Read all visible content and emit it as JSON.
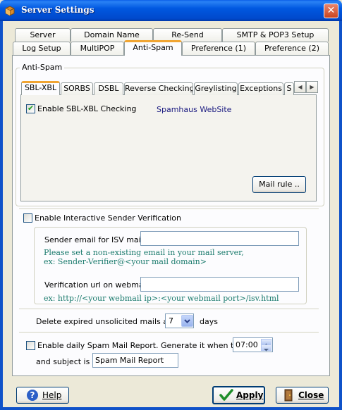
{
  "window": {
    "title": "Server Settings",
    "close_glyph": "✕"
  },
  "tabs_row1": [
    "Server",
    "Domain Name",
    "Re-Send",
    "SMTP & POP3 Setup"
  ],
  "tabs_row2": [
    "Log Setup",
    "MultiPOP",
    "Anti-Spam",
    "Preference (1)",
    "Preference (2)"
  ],
  "active_tab": "Anti-Spam",
  "antispam": {
    "group_label": "Anti-Spam",
    "inner_tabs": [
      "SBL-XBL",
      "SORBS",
      "DSBL",
      "Reverse Checking",
      "Greylisting",
      "Exceptions",
      "S"
    ],
    "active_inner_tab": "SBL-XBL",
    "sbl": {
      "enable_label": "Enable SBL-XBL Checking",
      "enable_checked": true,
      "website_link": "Spamhaus WebSite",
      "mail_rule_button": "Mail rule .."
    }
  },
  "isv": {
    "enable_label": "Enable Interactive Sender Verification",
    "enable_checked": false,
    "sender_label": "Sender email for ISV mail :",
    "sender_value": "",
    "hint1": "Please set a non-existing email in your mail server,",
    "hint2": "ex: Sender-Verifier@<your mail domain>",
    "url_label": "Verification url on webmail :",
    "url_value": "",
    "hint3": "ex: http://<your webmail ip>:<your webmail port>/isv.html"
  },
  "expire": {
    "label_before": "Delete expired unsolicited mails after",
    "days_value": "7",
    "label_after": "days"
  },
  "report": {
    "enable_label": "Enable daily Spam Mail Report.  Generate it when time is",
    "enable_checked": false,
    "time_value": "07:00",
    "subject_label": "and subject is",
    "subject_value": "Spam Mail Report"
  },
  "buttons": {
    "help": "Help",
    "apply": "Apply",
    "close": "Close"
  },
  "colors": {
    "titlebar": "#0058E0",
    "active_tab_accent": "#F1A532",
    "hint_text": "#1B7B6D",
    "check_green": "#21A121"
  }
}
